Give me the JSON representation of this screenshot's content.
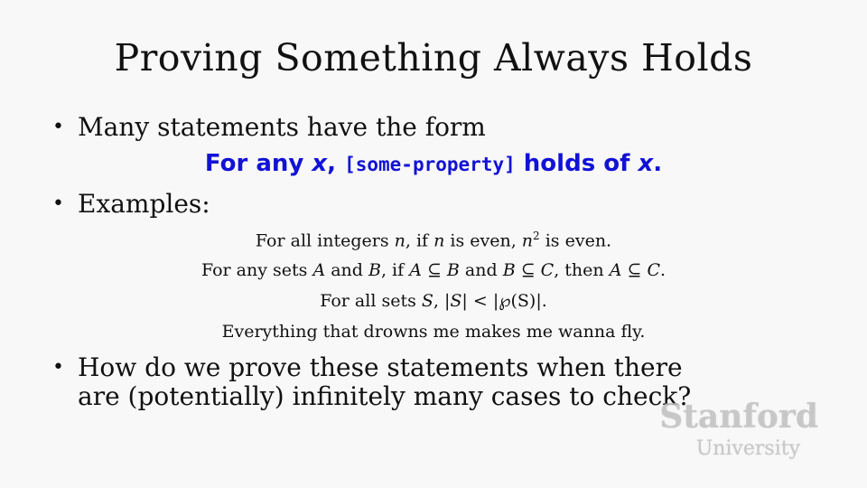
{
  "slide": {
    "title": "Proving Something Always Holds",
    "bullets": [
      {
        "text": "Many statements have the form"
      },
      {
        "text": "Examples:"
      },
      {
        "line1": "How do we prove these statements when there",
        "line2": "are (potentially) infinitely many cases to check?"
      }
    ],
    "bullet_symbol": "•",
    "emphasis": {
      "part1": "For any ",
      "var1": "x",
      "part2": ", ",
      "code": "[some-property]",
      "part3": " holds of ",
      "var2": "x",
      "part4": ".",
      "color": "#1212d6"
    },
    "examples": {
      "ex1": {
        "a": "For all integers ",
        "n1": "n",
        "b": ", if ",
        "n2": "n",
        "c": " is even, ",
        "n3": "n",
        "sup": "2",
        "d": " is even."
      },
      "ex2": {
        "a": "For any sets ",
        "A1": "A",
        "b": " and ",
        "B1": "B",
        "c": ", if ",
        "A2": "A",
        "d": " ⊆ ",
        "B2": "B",
        "e": " and ",
        "B3": "B",
        "f": " ⊆ ",
        "C1": "C",
        "g": ", then ",
        "A3": "A",
        "h": " ⊆ ",
        "C2": "C",
        "i": "."
      },
      "ex3": {
        "a": "For all sets ",
        "S1": "S",
        "b": ", |",
        "S2": "S",
        "c": "| < |℘(S)|."
      },
      "ex4": "Everything that drowns me makes me wanna fly."
    },
    "watermark": {
      "line1": "Stanford",
      "line2": "University"
    }
  }
}
